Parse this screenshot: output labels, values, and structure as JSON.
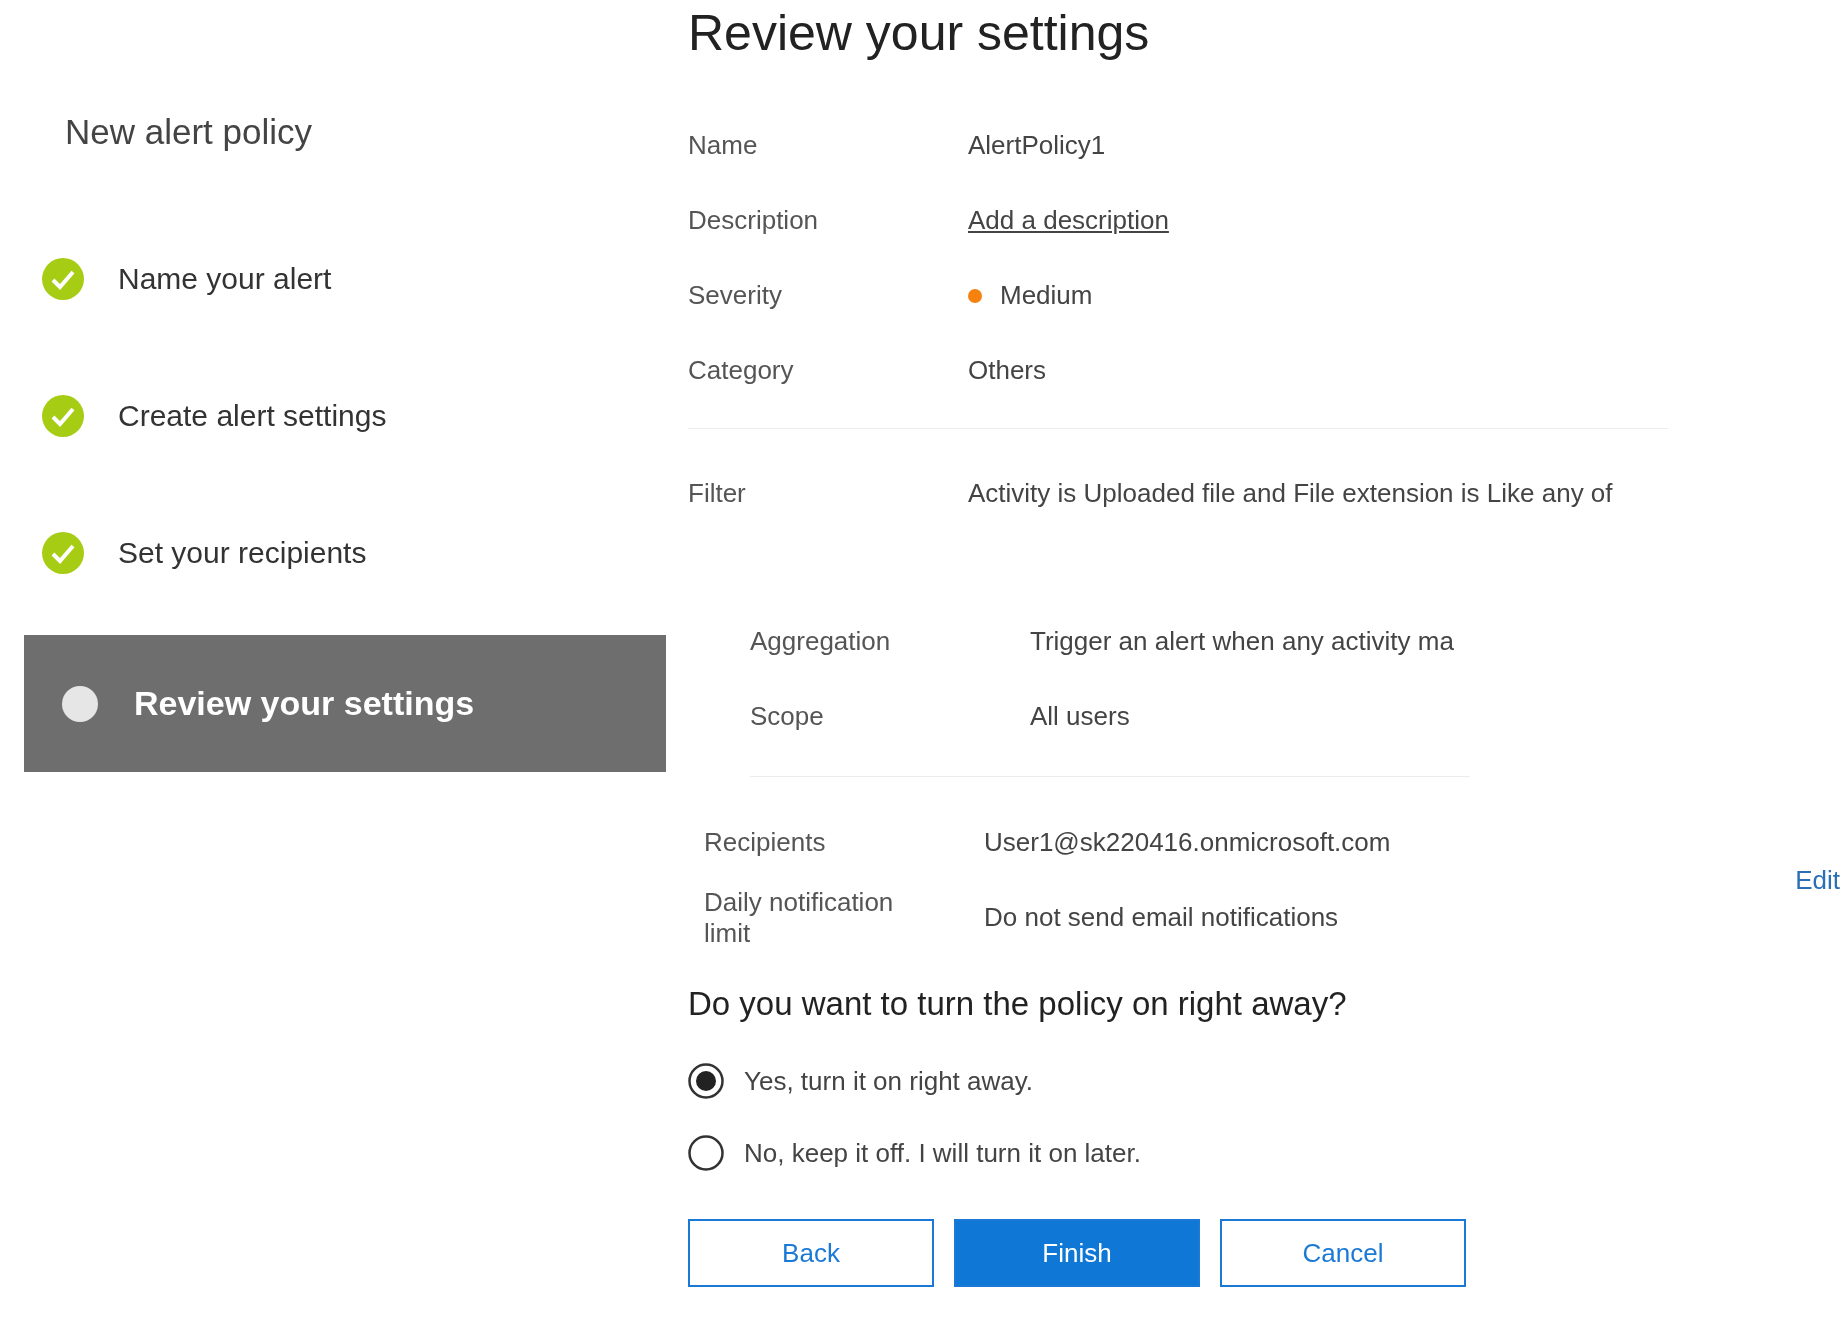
{
  "wizard": {
    "title": "New alert policy",
    "steps": [
      {
        "label": "Name your alert",
        "completed": true,
        "selected": false
      },
      {
        "label": "Create alert settings",
        "completed": true,
        "selected": false
      },
      {
        "label": "Set your recipients",
        "completed": true,
        "selected": false
      },
      {
        "label": "Review your settings",
        "completed": false,
        "selected": true
      }
    ]
  },
  "review": {
    "title": "Review your settings",
    "sections": [
      {
        "rows": [
          {
            "label": "Name",
            "value": "AlertPolicy1",
            "kind": "text"
          },
          {
            "label": "Description",
            "value": "Add a description",
            "kind": "link"
          },
          {
            "label": "Severity",
            "value": "Medium",
            "kind": "severity",
            "color": "#f5820f"
          },
          {
            "label": "Category",
            "value": "Others",
            "kind": "text"
          }
        ]
      },
      {
        "rows": [
          {
            "label": "Filter",
            "value": "Activity is Uploaded file and File extension is Like any of",
            "kind": "text"
          }
        ]
      },
      {
        "rows": [
          {
            "label": "Aggregation",
            "value": "Trigger an alert when any activity ma",
            "kind": "text"
          },
          {
            "label": "Scope",
            "value": "All users",
            "kind": "text"
          }
        ]
      },
      {
        "rows": [
          {
            "label": "Recipients",
            "value": "User1@sk220416.onmicrosoft.com",
            "kind": "text"
          },
          {
            "label": "Daily notification limit",
            "value": "Do not send email notifications",
            "kind": "text"
          }
        ],
        "edit": "Edit"
      }
    ]
  },
  "activation": {
    "question": "Do you want to turn the policy on right away?",
    "options": [
      {
        "label": "Yes, turn it on right away.",
        "selected": true
      },
      {
        "label": "No, keep it off. I will turn it on later.",
        "selected": false
      }
    ]
  },
  "buttons": [
    {
      "label": "Back",
      "kind": "secondary"
    },
    {
      "label": "Finish",
      "kind": "primary"
    },
    {
      "label": "Cancel",
      "kind": "secondary"
    }
  ]
}
